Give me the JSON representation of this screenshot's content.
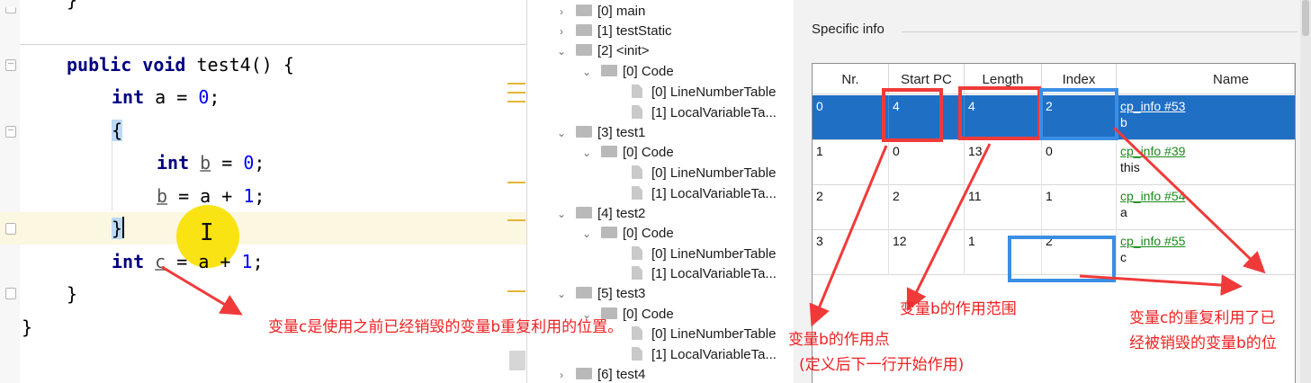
{
  "editor": {
    "lines": {
      "l1_kw": "public void",
      "l1_rest": " test4() {",
      "l2_kw": "int",
      "l2_a": " a = ",
      "l2_num": "0",
      "l2_end": ";",
      "l3": "{",
      "l4_kw": "int",
      "l4_sp": " ",
      "l4_var": "b",
      "l4_eq": " = ",
      "l4_num": "0",
      "l4_end": ";",
      "l5_var": "b",
      "l5_mid": " = a + ",
      "l5_num": "1",
      "l5_end": ";",
      "l6": "}",
      "l7_kw": "int",
      "l7_sp": " ",
      "l7_var": "c",
      "l7_mid": " = a + ",
      "l7_num": "1",
      "l7_end": ";",
      "l8": "}",
      "l9": "}",
      "l0": "}"
    },
    "cursor_glyph": "I"
  },
  "tree": {
    "items": [
      {
        "label": "[0] main"
      },
      {
        "label": "[1] testStatic"
      },
      {
        "label": "[2] <init>"
      },
      {
        "label": "[0] Code"
      },
      {
        "label": "[0] LineNumberTable"
      },
      {
        "label": "[1] LocalVariableTa..."
      },
      {
        "label": "[3] test1"
      },
      {
        "label": "[0] Code"
      },
      {
        "label": "[0] LineNumberTable"
      },
      {
        "label": "[1] LocalVariableTa..."
      },
      {
        "label": "[4] test2"
      },
      {
        "label": "[0] Code"
      },
      {
        "label": "[0] LineNumberTable"
      },
      {
        "label": "[1] LocalVariableTa..."
      },
      {
        "label": "[5] test3"
      },
      {
        "label": "[0] Code"
      },
      {
        "label": "[0] LineNumberTable"
      },
      {
        "label": "[1] LocalVariableTa..."
      },
      {
        "label": "[6] test4"
      }
    ],
    "chevrons": {
      "collapsed": "›",
      "expanded": "⌄"
    }
  },
  "panel": {
    "title": "Specific info",
    "columns": [
      "Nr.",
      "Start PC",
      "Length",
      "Index",
      "Name"
    ],
    "rows": [
      {
        "nr": "0",
        "start_pc": "4",
        "length": "4",
        "index": "2",
        "name_link": "cp_info #53",
        "name": "b",
        "selected": true
      },
      {
        "nr": "1",
        "start_pc": "0",
        "length": "13",
        "index": "0",
        "name_link": "cp_info #39",
        "name": "this",
        "selected": false
      },
      {
        "nr": "2",
        "start_pc": "2",
        "length": "11",
        "index": "1",
        "name_link": "cp_info #54",
        "name": "a",
        "selected": false
      },
      {
        "nr": "3",
        "start_pc": "12",
        "length": "1",
        "index": "2",
        "name_link": "cp_info #55",
        "name": "c",
        "selected": false
      }
    ]
  },
  "annotations": {
    "note_reuse_position": "变量c是使用之前已经销毁的变量b重复利用的位置。",
    "note_b_point_1": "变量b的作用点",
    "note_b_point_2": "(定义后下一行开始作用)",
    "note_b_range": "变量b的作用范围",
    "note_c_reuse_1": "变量c的重复利用了已",
    "note_c_reuse_2": "经被销毁的变量b的位"
  },
  "colors": {
    "annotation_red": "#ee2222",
    "annotation_blue": "#3a8ee6",
    "selection_blue": "#1f6fc5",
    "link_green": "#1b8a1b",
    "keyword_navy": "#000080",
    "number_blue": "#0000ff"
  }
}
